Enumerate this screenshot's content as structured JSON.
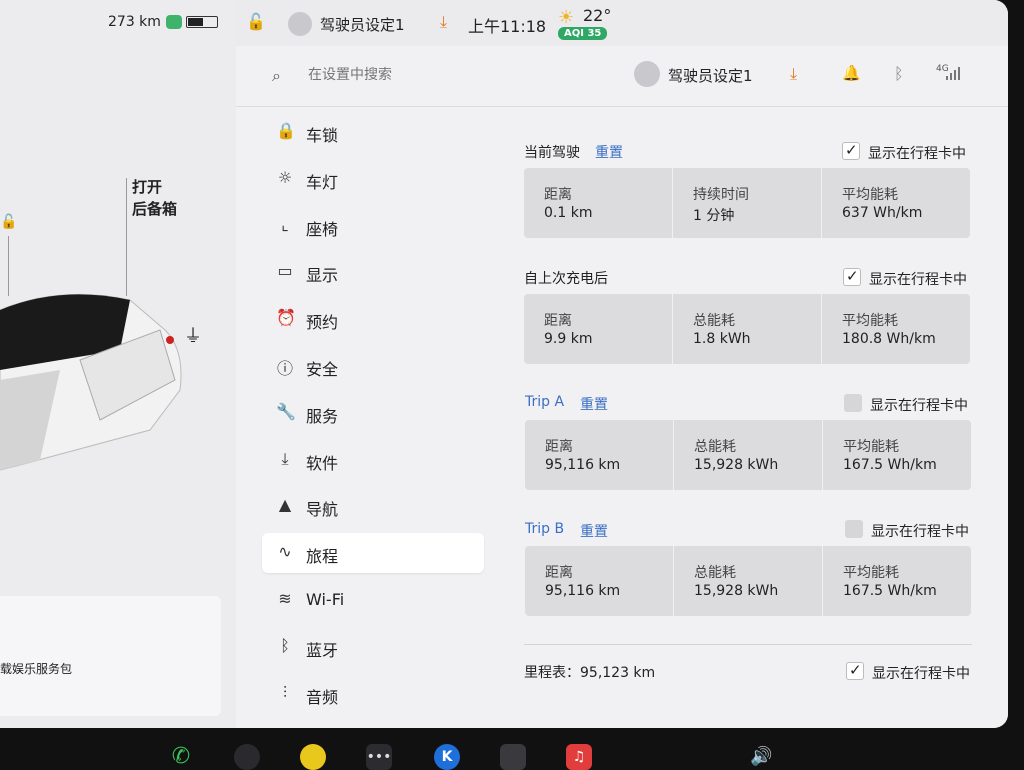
{
  "status": {
    "range": "273 km",
    "battery_level": 0.55
  },
  "car": {
    "trunk_label_1": "打开",
    "trunk_label_2": "后备箱",
    "promo_text": "载娱乐服务包"
  },
  "topbar": {
    "profile": "驾驶员设定1",
    "time": "上午11:18",
    "temperature": "22°",
    "aqi": "AQI 35"
  },
  "header": {
    "search_placeholder": "在设置中搜索",
    "profile": "驾驶员设定1",
    "network": "4G"
  },
  "nav": [
    {
      "label": "车锁",
      "icon": "lock-icon"
    },
    {
      "label": "车灯",
      "icon": "light-icon"
    },
    {
      "label": "座椅",
      "icon": "seat-icon"
    },
    {
      "label": "显示",
      "icon": "display-icon"
    },
    {
      "label": "预约",
      "icon": "schedule-icon"
    },
    {
      "label": "安全",
      "icon": "safety-icon"
    },
    {
      "label": "服务",
      "icon": "wrench-icon"
    },
    {
      "label": "软件",
      "icon": "download-icon"
    },
    {
      "label": "导航",
      "icon": "navigation-icon"
    },
    {
      "label": "旅程",
      "icon": "trips-icon",
      "active": true
    },
    {
      "label": "Wi-Fi",
      "icon": "wifi-icon"
    },
    {
      "label": "蓝牙",
      "icon": "bluetooth-icon"
    },
    {
      "label": "音频",
      "icon": "audio-icon"
    }
  ],
  "trips": {
    "show_label": "显示在行程卡中",
    "reset_label": "重置",
    "current": {
      "title": "当前驾驶",
      "checked": true,
      "cells": [
        {
          "label": "距离",
          "value": "0.1 km"
        },
        {
          "label": "持续时间",
          "value": "1 分钟"
        },
        {
          "label": "平均能耗",
          "value": "637 Wh/km"
        }
      ]
    },
    "since_charge": {
      "title": "自上次充电后",
      "checked": true,
      "cells": [
        {
          "label": "距离",
          "value": "9.9 km"
        },
        {
          "label": "总能耗",
          "value": "1.8 kWh"
        },
        {
          "label": "平均能耗",
          "value": "180.8 Wh/km"
        }
      ]
    },
    "trip_a": {
      "title": "Trip A",
      "checked": false,
      "cells": [
        {
          "label": "距离",
          "value": "95,116 km"
        },
        {
          "label": "总能耗",
          "value": "15,928 kWh"
        },
        {
          "label": "平均能耗",
          "value": "167.5 Wh/km"
        }
      ]
    },
    "trip_b": {
      "title": "Trip B",
      "checked": false,
      "cells": [
        {
          "label": "距离",
          "value": "95,116 km"
        },
        {
          "label": "总能耗",
          "value": "15,928 kWh"
        },
        {
          "label": "平均能耗",
          "value": "167.5 Wh/km"
        }
      ]
    },
    "odometer": "里程表：95,123 km",
    "odometer_checked": true
  },
  "colors": {
    "accent_blue": "#3b6fc4",
    "download_orange": "#e07b20",
    "aqi_green": "#2fa866"
  }
}
